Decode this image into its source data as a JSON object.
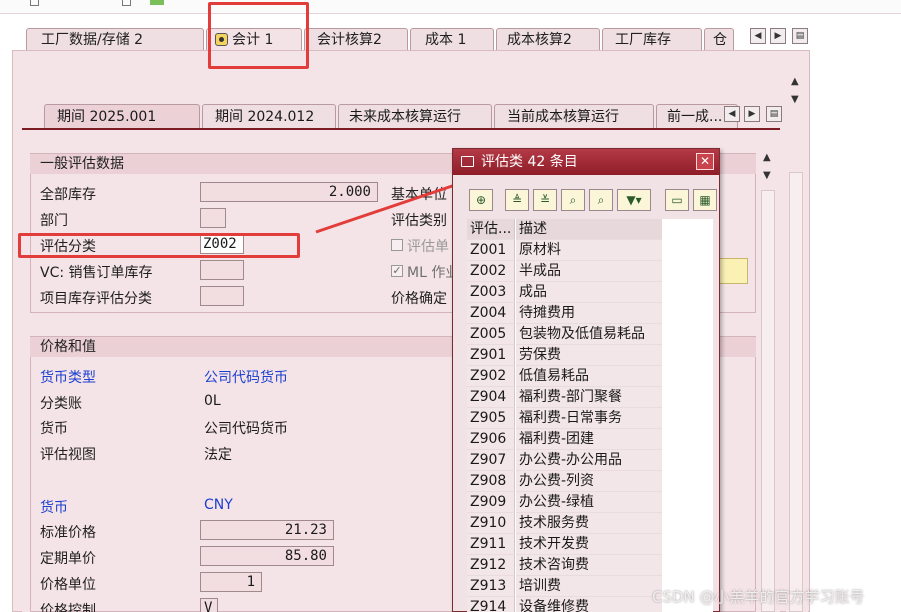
{
  "outer_tabs": [
    {
      "label": "工厂数据/存储 2"
    },
    {
      "label": "会计 1"
    },
    {
      "label": "会计核算2"
    },
    {
      "label": "成本 1"
    },
    {
      "label": "成本核算2"
    },
    {
      "label": "工厂库存"
    },
    {
      "label": "仓"
    }
  ],
  "inner_tabs": [
    {
      "label": "期间 2025.001"
    },
    {
      "label": "期间 2024.012"
    },
    {
      "label": "未来成本核算运行"
    },
    {
      "label": "当前成本核算运行"
    },
    {
      "label": "前一成..."
    }
  ],
  "general": {
    "title": "一般评估数据",
    "total_stock_label": "全部库存",
    "total_stock_value": "2.000",
    "division_label": "部门",
    "division_value": "",
    "valuation_class_label": "评估分类",
    "valuation_class_value": "Z002",
    "vc_sales_label": "VC: 销售订单库存",
    "vc_sales_value": "",
    "project_stock_label": "项目库存评估分类",
    "project_stock_value": "",
    "base_unit_label": "基本单位",
    "valuation_cat_label": "评估类别",
    "valuation_unit_label": "评估单",
    "ml_label": "ML 作业",
    "price_determ_label": "价格确定"
  },
  "prices": {
    "title": "价格和值",
    "currency_type_label": "货币类型",
    "currency_type_value": "公司代码货币",
    "ledger_label": "分类账",
    "ledger_value": "0L",
    "currency_label": "货币",
    "currency_value": "公司代码货币",
    "valuation_view_label": "评估视图",
    "valuation_view_value": "法定",
    "currency2_label": "货币",
    "currency2_value": "CNY",
    "std_price_label": "标准价格",
    "std_price_value": "21.23",
    "periodic_price_label": "定期单价",
    "periodic_price_value": "85.80",
    "price_unit_label": "价格单位",
    "price_unit_value": "1",
    "price_control_label": "价格控制",
    "price_control_value": "V"
  },
  "popup": {
    "title": "评估类 42 条目",
    "col_code": "评估...",
    "col_desc": "描述",
    "rows": [
      {
        "code": "Z001",
        "desc": "原材料"
      },
      {
        "code": "Z002",
        "desc": "半成品"
      },
      {
        "code": "Z003",
        "desc": "成品"
      },
      {
        "code": "Z004",
        "desc": "待摊费用"
      },
      {
        "code": "Z005",
        "desc": "包装物及低值易耗品"
      },
      {
        "code": "Z901",
        "desc": "劳保费"
      },
      {
        "code": "Z902",
        "desc": "低值易耗品"
      },
      {
        "code": "Z904",
        "desc": "福利费-部门聚餐"
      },
      {
        "code": "Z905",
        "desc": "福利费-日常事务"
      },
      {
        "code": "Z906",
        "desc": "福利费-团建"
      },
      {
        "code": "Z907",
        "desc": "办公费-办公用品"
      },
      {
        "code": "Z908",
        "desc": "办公费-列资"
      },
      {
        "code": "Z909",
        "desc": "办公费-绿植"
      },
      {
        "code": "Z910",
        "desc": "技术服务费"
      },
      {
        "code": "Z911",
        "desc": "技术开发费"
      },
      {
        "code": "Z912",
        "desc": "技术咨询费"
      },
      {
        "code": "Z913",
        "desc": "培训费"
      },
      {
        "code": "Z914",
        "desc": "设备维修费"
      }
    ]
  },
  "watermark": "CSDN @小羔羊的官方学习账号",
  "colors": {
    "panel": "#f5e4e7",
    "popup_title": "#8e1d28",
    "annotation": "#e23d3a",
    "link_blue": "#1c3fd0"
  }
}
